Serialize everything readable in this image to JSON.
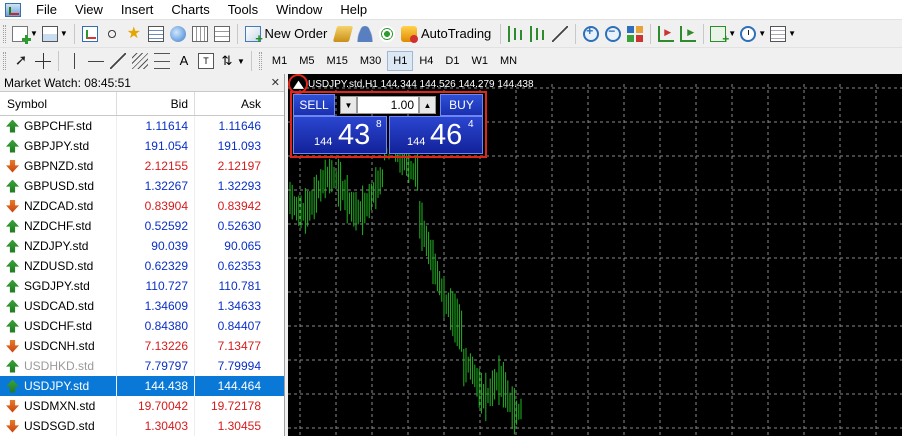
{
  "menu": [
    "File",
    "View",
    "Insert",
    "Charts",
    "Tools",
    "Window",
    "Help"
  ],
  "toolbar": {
    "new_order_label": "New Order",
    "autotrading_label": "AutoTrading",
    "timeframes": [
      "M1",
      "M5",
      "M15",
      "M30",
      "H1",
      "H4",
      "D1",
      "W1",
      "MN"
    ],
    "active_timeframe": "H1"
  },
  "market_watch": {
    "title": "Market Watch: 08:45:51",
    "columns": {
      "symbol": "Symbol",
      "bid": "Bid",
      "ask": "Ask"
    },
    "rows": [
      {
        "symbol": "GBPCHF.std",
        "bid": "1.11614",
        "ask": "1.11646",
        "direction": "up"
      },
      {
        "symbol": "GBPJPY.std",
        "bid": "191.054",
        "ask": "191.093",
        "direction": "up"
      },
      {
        "symbol": "GBPNZD.std",
        "bid": "2.12155",
        "ask": "2.12197",
        "direction": "down"
      },
      {
        "symbol": "GBPUSD.std",
        "bid": "1.32267",
        "ask": "1.32293",
        "direction": "up"
      },
      {
        "symbol": "NZDCAD.std",
        "bid": "0.83904",
        "ask": "0.83942",
        "direction": "down"
      },
      {
        "symbol": "NZDCHF.std",
        "bid": "0.52592",
        "ask": "0.52630",
        "direction": "up"
      },
      {
        "symbol": "NZDJPY.std",
        "bid": "90.039",
        "ask": "90.065",
        "direction": "up"
      },
      {
        "symbol": "NZDUSD.std",
        "bid": "0.62329",
        "ask": "0.62353",
        "direction": "up"
      },
      {
        "symbol": "SGDJPY.std",
        "bid": "110.727",
        "ask": "110.781",
        "direction": "up"
      },
      {
        "symbol": "USDCAD.std",
        "bid": "1.34609",
        "ask": "1.34633",
        "direction": "up"
      },
      {
        "symbol": "USDCHF.std",
        "bid": "0.84380",
        "ask": "0.84407",
        "direction": "up"
      },
      {
        "symbol": "USDCNH.std",
        "bid": "7.13226",
        "ask": "7.13477",
        "direction": "down"
      },
      {
        "symbol": "USDHKD.std",
        "bid": "7.79797",
        "ask": "7.79994",
        "direction": "up",
        "disabled": true
      },
      {
        "symbol": "USDJPY.std",
        "bid": "144.438",
        "ask": "144.464",
        "direction": "up",
        "selected": true
      },
      {
        "symbol": "USDMXN.std",
        "bid": "19.70042",
        "ask": "19.72178",
        "direction": "down"
      },
      {
        "symbol": "USDSGD.std",
        "bid": "1.30403",
        "ask": "1.30455",
        "direction": "down"
      }
    ]
  },
  "chart": {
    "title": "USDJPY.std,H1  144.344 144.526 144.279 144.438",
    "one_click": {
      "sell_label": "SELL",
      "buy_label": "BUY",
      "lot_value": "1.00",
      "sell_price": {
        "prefix": "144",
        "big": "43",
        "sup": "8"
      },
      "buy_price": {
        "prefix": "144",
        "big": "46",
        "sup": "4"
      }
    }
  },
  "colors": {
    "up_price": "#0a2fc8",
    "down_price": "#d61b1b",
    "candle": "#22b422",
    "highlight": "#e0251b",
    "selected_row": "#0a78d7"
  }
}
